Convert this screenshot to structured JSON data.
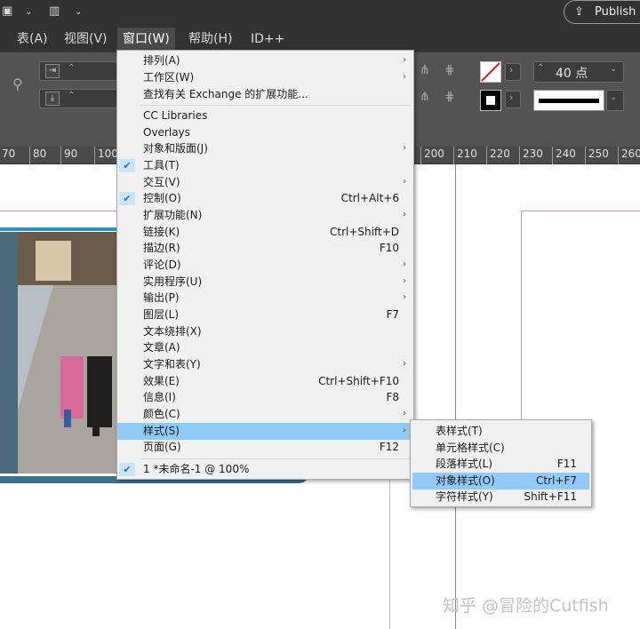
{
  "titlebar": {
    "publish_label": "Publish",
    "icons": [
      "frame-icon",
      "chevron-down-icon",
      "layout-icon",
      "chevron-down-icon",
      "publish-icon"
    ]
  },
  "menubar": {
    "items": [
      "表(A)",
      "视图(V)",
      "窗口(W)",
      "帮助(H)",
      "ID++"
    ],
    "active_index": 2
  },
  "controlbar": {
    "point_size": "40 点"
  },
  "ruler": {
    "marks": [
      "70",
      "80",
      "90",
      "100",
      "200",
      "210",
      "220",
      "230",
      "240",
      "250",
      "260"
    ]
  },
  "window_menu": {
    "items": [
      {
        "label": "排列(A)",
        "submenu": true
      },
      {
        "label": "工作区(W)",
        "submenu": true
      },
      {
        "label": "查找有关 Exchange 的扩展功能..."
      },
      {
        "label": "CC Libraries"
      },
      {
        "label": "Overlays"
      },
      {
        "label": "对象和版面(J)",
        "submenu": true
      },
      {
        "label": "工具(T)",
        "checked": true
      },
      {
        "label": "交互(V)",
        "submenu": true
      },
      {
        "label": "控制(O)",
        "shortcut": "Ctrl+Alt+6",
        "checked": true
      },
      {
        "label": "扩展功能(N)",
        "submenu": true
      },
      {
        "label": "链接(K)",
        "shortcut": "Ctrl+Shift+D"
      },
      {
        "label": "描边(R)",
        "shortcut": "F10"
      },
      {
        "label": "评论(D)",
        "submenu": true
      },
      {
        "label": "实用程序(U)",
        "submenu": true
      },
      {
        "label": "输出(P)",
        "submenu": true
      },
      {
        "label": "图层(L)",
        "shortcut": "F7"
      },
      {
        "label": "文本绕排(X)"
      },
      {
        "label": "文章(A)"
      },
      {
        "label": "文字和表(Y)",
        "submenu": true
      },
      {
        "label": "效果(E)",
        "shortcut": "Ctrl+Shift+F10"
      },
      {
        "label": "信息(I)",
        "shortcut": "F8"
      },
      {
        "label": "颜色(C)",
        "submenu": true
      },
      {
        "label": "样式(S)",
        "submenu": true,
        "highlighted": true
      },
      {
        "label": "页面(G)",
        "shortcut": "F12"
      },
      {
        "label": "1 *未命名-1 @ 100%",
        "checked": true
      }
    ]
  },
  "styles_submenu": {
    "items": [
      {
        "label": "表样式(T)",
        "shortcut": ""
      },
      {
        "label": "单元格样式(C)",
        "shortcut": ""
      },
      {
        "label": "段落样式(L)",
        "shortcut": "F11"
      },
      {
        "label": "对象样式(O)",
        "shortcut": "Ctrl+F7",
        "highlighted": true
      },
      {
        "label": "字符样式(Y)",
        "shortcut": "Shift+F11"
      }
    ]
  },
  "watermark": "知乎 @冒险的Cutfish",
  "colors": {
    "ui_dark": "#323232",
    "panel": "#535353",
    "menu_bg": "#f0f0f0",
    "highlight": "#91c9f7",
    "check_blue": "#2a72c2",
    "guide_magenta": "#d88be0",
    "frame_blue": "#2f8fc9"
  }
}
